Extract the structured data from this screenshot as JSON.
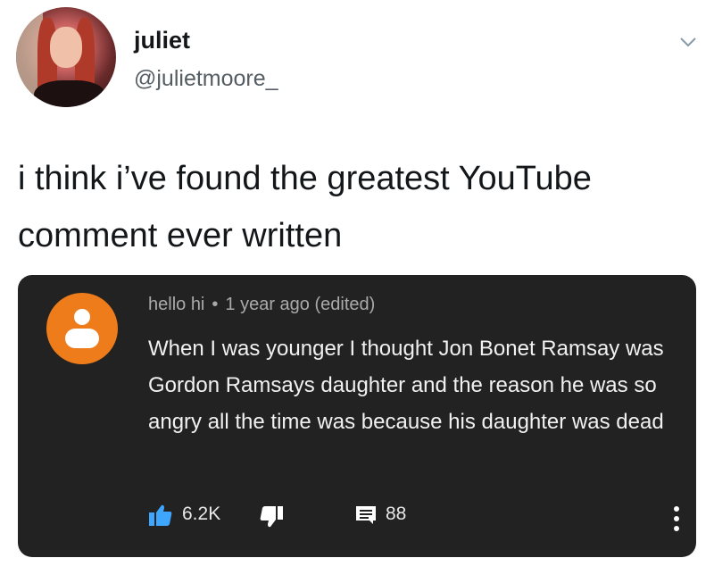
{
  "tweet": {
    "display_name": "juliet",
    "handle": "@julietmoore_",
    "text_line1": "i think i’ve found the greatest YouTube",
    "text_line2": "comment ever written"
  },
  "comment": {
    "author": "hello hi",
    "separator": "•",
    "time": "1 year ago (edited)",
    "body": "When I was younger I thought Jon Bonet Ramsay was Gordon Ramsays daughter and the reason he was so angry all the time was because his daughter was dead",
    "likes": "6.2K",
    "replies": "88"
  },
  "colors": {
    "card_background": "#222222",
    "avatar_orange": "#ef7c1a",
    "like_blue": "#3ea6ff"
  },
  "icons": [
    "chevron-down-icon",
    "thumbs-up-icon",
    "thumbs-down-icon",
    "comment-icon",
    "more-vertical-icon"
  ]
}
